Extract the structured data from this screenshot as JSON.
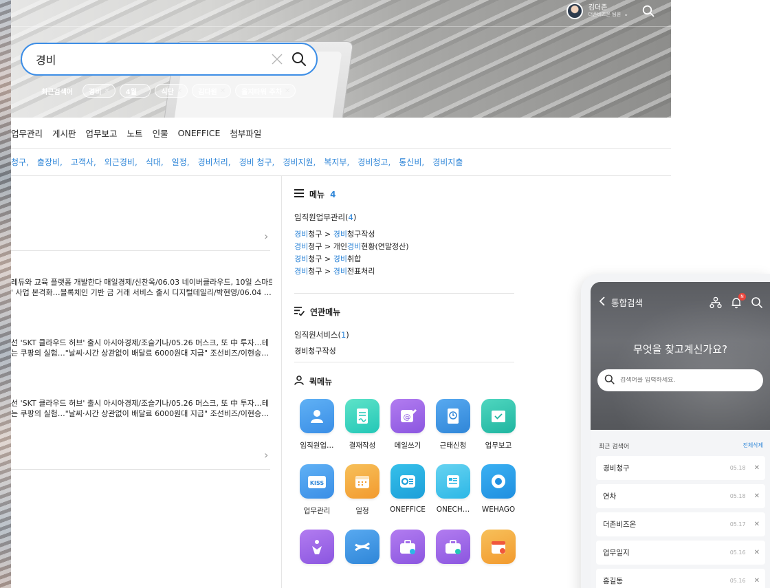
{
  "header": {
    "user_name": "김더존",
    "user_org": "더존비즈온 팀원",
    "search_value": "경비",
    "recent_label": "최근검색어",
    "recent_chips": [
      "경비",
      "4월",
      "식단",
      "김다원",
      "을지타워 주차"
    ]
  },
  "tabs": [
    "업무관리",
    "게시판",
    "업무보고",
    "노트",
    "인물",
    "ONEFFICE",
    "첨부파일"
  ],
  "related_terms": [
    "청구,",
    "출장비,",
    "고객사,",
    "외근경비,",
    "식대,",
    "일정,",
    "경비처리,",
    "경비 청구,",
    "경비지원,",
    "복지부,",
    "경비청고,",
    "통신비,",
    "경비지출"
  ],
  "news": {
    "block1": [
      "레듀와 교육 플랫폼 개발한다 매일경제/신찬옥/06.03 네이버클라우드, 10일 스마트",
      "' 사업 본격화…블록체인 기반 금 거래 서비스 출시 디지털데일리/박현영/06.04 …"
    ],
    "block2": [
      "선 'SKT 클라우드 허브' 출시 아시아경제/조슬기나/05.26 머스크, 또 中 투자…테",
      "는 쿠팡의 실험…\"날씨·시간 상관없이 배달료 6000원대 지급\" 조선비즈/이현승…"
    ],
    "block3": [
      "선 'SKT 클라우드 허브' 출시 아시아경제/조슬기나/05.26 머스크, 또 中 투자…테",
      "는 쿠팡의 실험…\"날씨·시간 상관없이 배달료 6000원대 지급\" 조선비즈/이현승…"
    ]
  },
  "menu_section": {
    "title": "메뉴",
    "count": "4",
    "group_label": "임직원업무관리(",
    "group_count": "4",
    "group_close": ")",
    "paths": [
      {
        "a": "경비",
        "b": "청구 > ",
        "c": "경비",
        "d": "청구작성"
      },
      {
        "a": "경비",
        "b": "청구 > 개인",
        "c": "경비",
        "d": "현황(연말정산)"
      },
      {
        "a": "경비",
        "b": "청구 > ",
        "c": "경비",
        "d": "취합"
      },
      {
        "a": "경비",
        "b": "청구 > ",
        "c": "경비",
        "d": "전표처리"
      }
    ]
  },
  "related_menu": {
    "title": "연관메뉴",
    "group_label": "임직원서비스(",
    "group_count": "1",
    "group_close": ")",
    "item": "경비청구작성"
  },
  "quick_menu": {
    "title": "퀵메뉴",
    "items": [
      {
        "label": "임직원업…",
        "icon": "person-card-icon",
        "color": "#3a8ee6",
        "color2": "#60b1f5"
      },
      {
        "label": "결재작성",
        "icon": "document-sign-icon",
        "color": "#23c7b7",
        "color2": "#5ee3c8"
      },
      {
        "label": "메일쓰기",
        "icon": "mail-write-icon",
        "color": "#8b56e0",
        "color2": "#b27cf0"
      },
      {
        "label": "근태신청",
        "icon": "clock-document-icon",
        "color": "#2f86d8",
        "color2": "#58a9f0"
      },
      {
        "label": "업무보고",
        "icon": "report-check-icon",
        "color": "#1fb5a0",
        "color2": "#4fd6bf"
      },
      {
        "label": "업무관리",
        "icon": "kiss-folder-icon",
        "color": "#3a8ee6",
        "color2": "#60b1f5"
      },
      {
        "label": "일정",
        "icon": "calendar-icon",
        "color": "#f29a2e",
        "color2": "#f7c05a"
      },
      {
        "label": "ONEFFICE",
        "icon": "oneffice-icon",
        "color": "#1c9fd9",
        "color2": "#36c0ea"
      },
      {
        "label": "ONECH…",
        "icon": "onechamber-icon",
        "color": "#2cb7e6",
        "color2": "#67d3f1"
      },
      {
        "label": "WEHAGO",
        "icon": "wehago-icon",
        "color": "#1f8fe0",
        "color2": "#3ab0f2"
      },
      {
        "label": "",
        "icon": "people-icon",
        "color": "#8b56e0",
        "color2": "#b27cf0"
      },
      {
        "label": "",
        "icon": "confluence-icon",
        "color": "#2f86d8",
        "color2": "#58a9f0"
      },
      {
        "label": "",
        "icon": "briefcase-clock-icon",
        "color": "#8b56e0",
        "color2": "#b27cf0"
      },
      {
        "label": "",
        "icon": "briefcase-check-icon",
        "color": "#8b56e0",
        "color2": "#b27cf0"
      },
      {
        "label": "",
        "icon": "calendar-clock-icon",
        "color": "#f29a2e",
        "color2": "#f7c05a"
      }
    ]
  },
  "mobile": {
    "title": "통합검색",
    "badge": "N",
    "heading": "무엇을 찾고계신가요?",
    "search_placeholder": "검색어를 입력하세요.",
    "recent_title": "최근 검색어",
    "clear_all": "전체삭제",
    "recent": [
      {
        "label": "경비청구",
        "date": "05.18"
      },
      {
        "label": "연차",
        "date": "05.18"
      },
      {
        "label": "더존비즈온",
        "date": "05.17"
      },
      {
        "label": "업무일지",
        "date": "05.16"
      },
      {
        "label": "홍길동",
        "date": "05.16"
      }
    ]
  },
  "colors": {
    "accent": "#2f86d8",
    "search_border": "#3d8ee6",
    "badge": "#e8453c"
  }
}
